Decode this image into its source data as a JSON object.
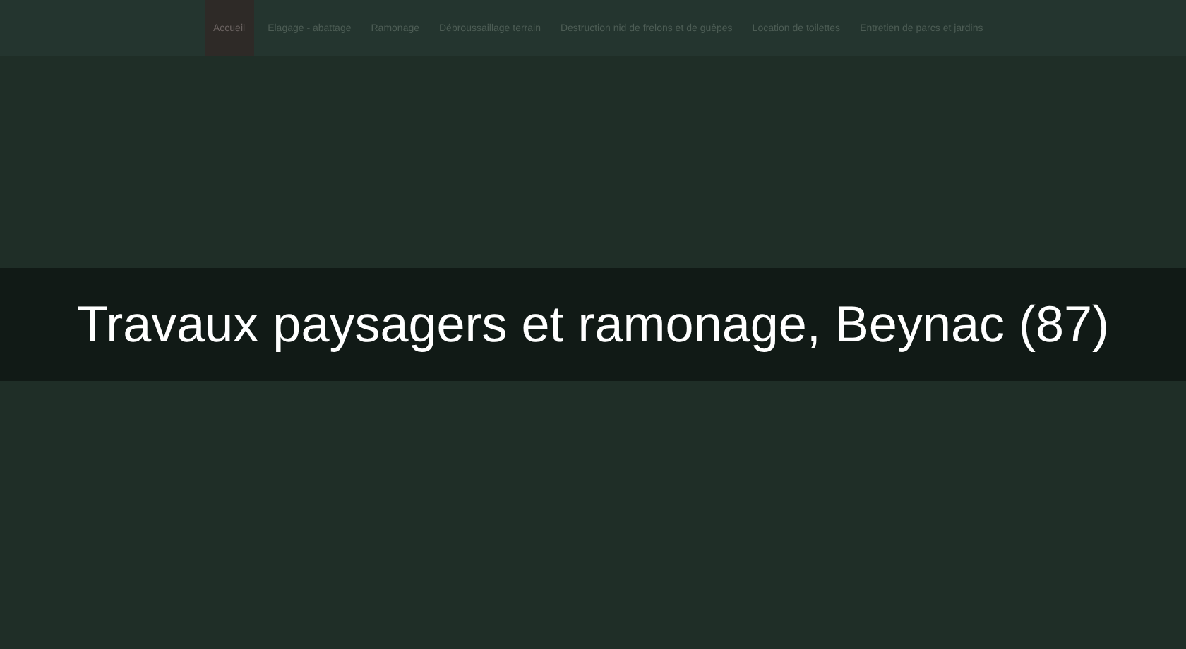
{
  "nav": {
    "items": [
      {
        "label": "Accueil",
        "selected": true
      },
      {
        "label": "Elagage - abattage",
        "selected": false
      },
      {
        "label": "Ramonage",
        "selected": false
      },
      {
        "label": "Débroussaillage terrain",
        "selected": false
      },
      {
        "label": "Destruction nid de frelons et de guêpes",
        "selected": false
      },
      {
        "label": "Location de toilettes",
        "selected": false
      },
      {
        "label": "Entretien de parcs et jardins",
        "selected": false
      }
    ]
  },
  "banner": {
    "title": "Travaux paysagers et ramonage, Beynac (87)"
  }
}
